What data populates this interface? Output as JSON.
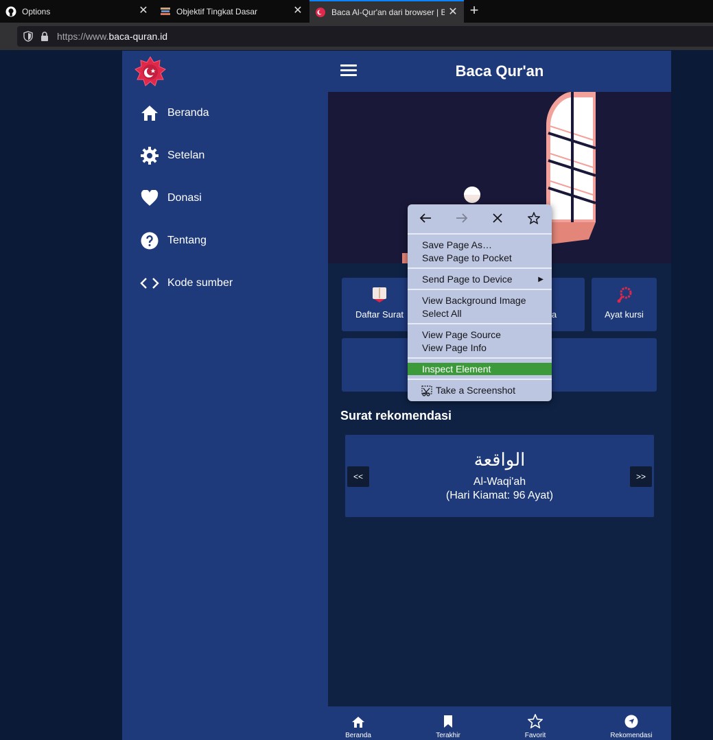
{
  "browser": {
    "tabs": [
      {
        "title": "Options",
        "icon": "github-icon",
        "active": false
      },
      {
        "title": "Objektif Tingkat Dasar",
        "icon": "book-stack-icon",
        "active": false
      },
      {
        "title": "Baca Al-Qur'an dari browser | B",
        "icon": "baca-quran-favicon",
        "active": true
      }
    ],
    "close_glyph": "✕",
    "newtab_glyph": "+",
    "url_prefix": "https://www.",
    "url_domain": "baca-quran.id"
  },
  "sidebar": {
    "items": [
      {
        "label": "Beranda",
        "icon": "home-icon"
      },
      {
        "label": "Setelan",
        "icon": "gear-icon"
      },
      {
        "label": "Donasi",
        "icon": "heart-icon"
      },
      {
        "label": "Tentang",
        "icon": "help-circle-icon"
      },
      {
        "label": "Kode sumber",
        "icon": "code-icon"
      }
    ]
  },
  "header": {
    "title": "Baca Qur'an"
  },
  "cards": {
    "daftar": "Daftar Surat",
    "asmaul": "usna",
    "ayat": "Ayat kursi"
  },
  "recommendation": {
    "section_title": "Surat rekomendasi",
    "arabic": "الواقعة",
    "latin": "Al-Waqi'ah",
    "desc": "(Hari Kiamat: 96 Ayat)",
    "prev": "<<",
    "next": ">>"
  },
  "bottom_nav": [
    {
      "label": "Beranda",
      "icon": "home-icon"
    },
    {
      "label": "Terakhir",
      "icon": "bookmark-icon"
    },
    {
      "label": "Favorit",
      "icon": "star-icon"
    },
    {
      "label": "Rekomendasi",
      "icon": "compass-icon"
    }
  ],
  "context_menu": {
    "items": {
      "save_as": "Save Page As…",
      "save_pocket": "Save Page to Pocket",
      "send_device": "Send Page to Device",
      "view_bg": "View Background Image",
      "select_all": "Select All",
      "view_source": "View Page Source",
      "view_info": "View Page Info",
      "inspect": "Inspect Element",
      "screenshot": "Take a Screenshot"
    },
    "highlight_color": "#3c9a3a"
  },
  "colors": {
    "page_bg": "#0b1a36",
    "panel": "#1e3a7b",
    "accent_red": "#e0284a"
  }
}
